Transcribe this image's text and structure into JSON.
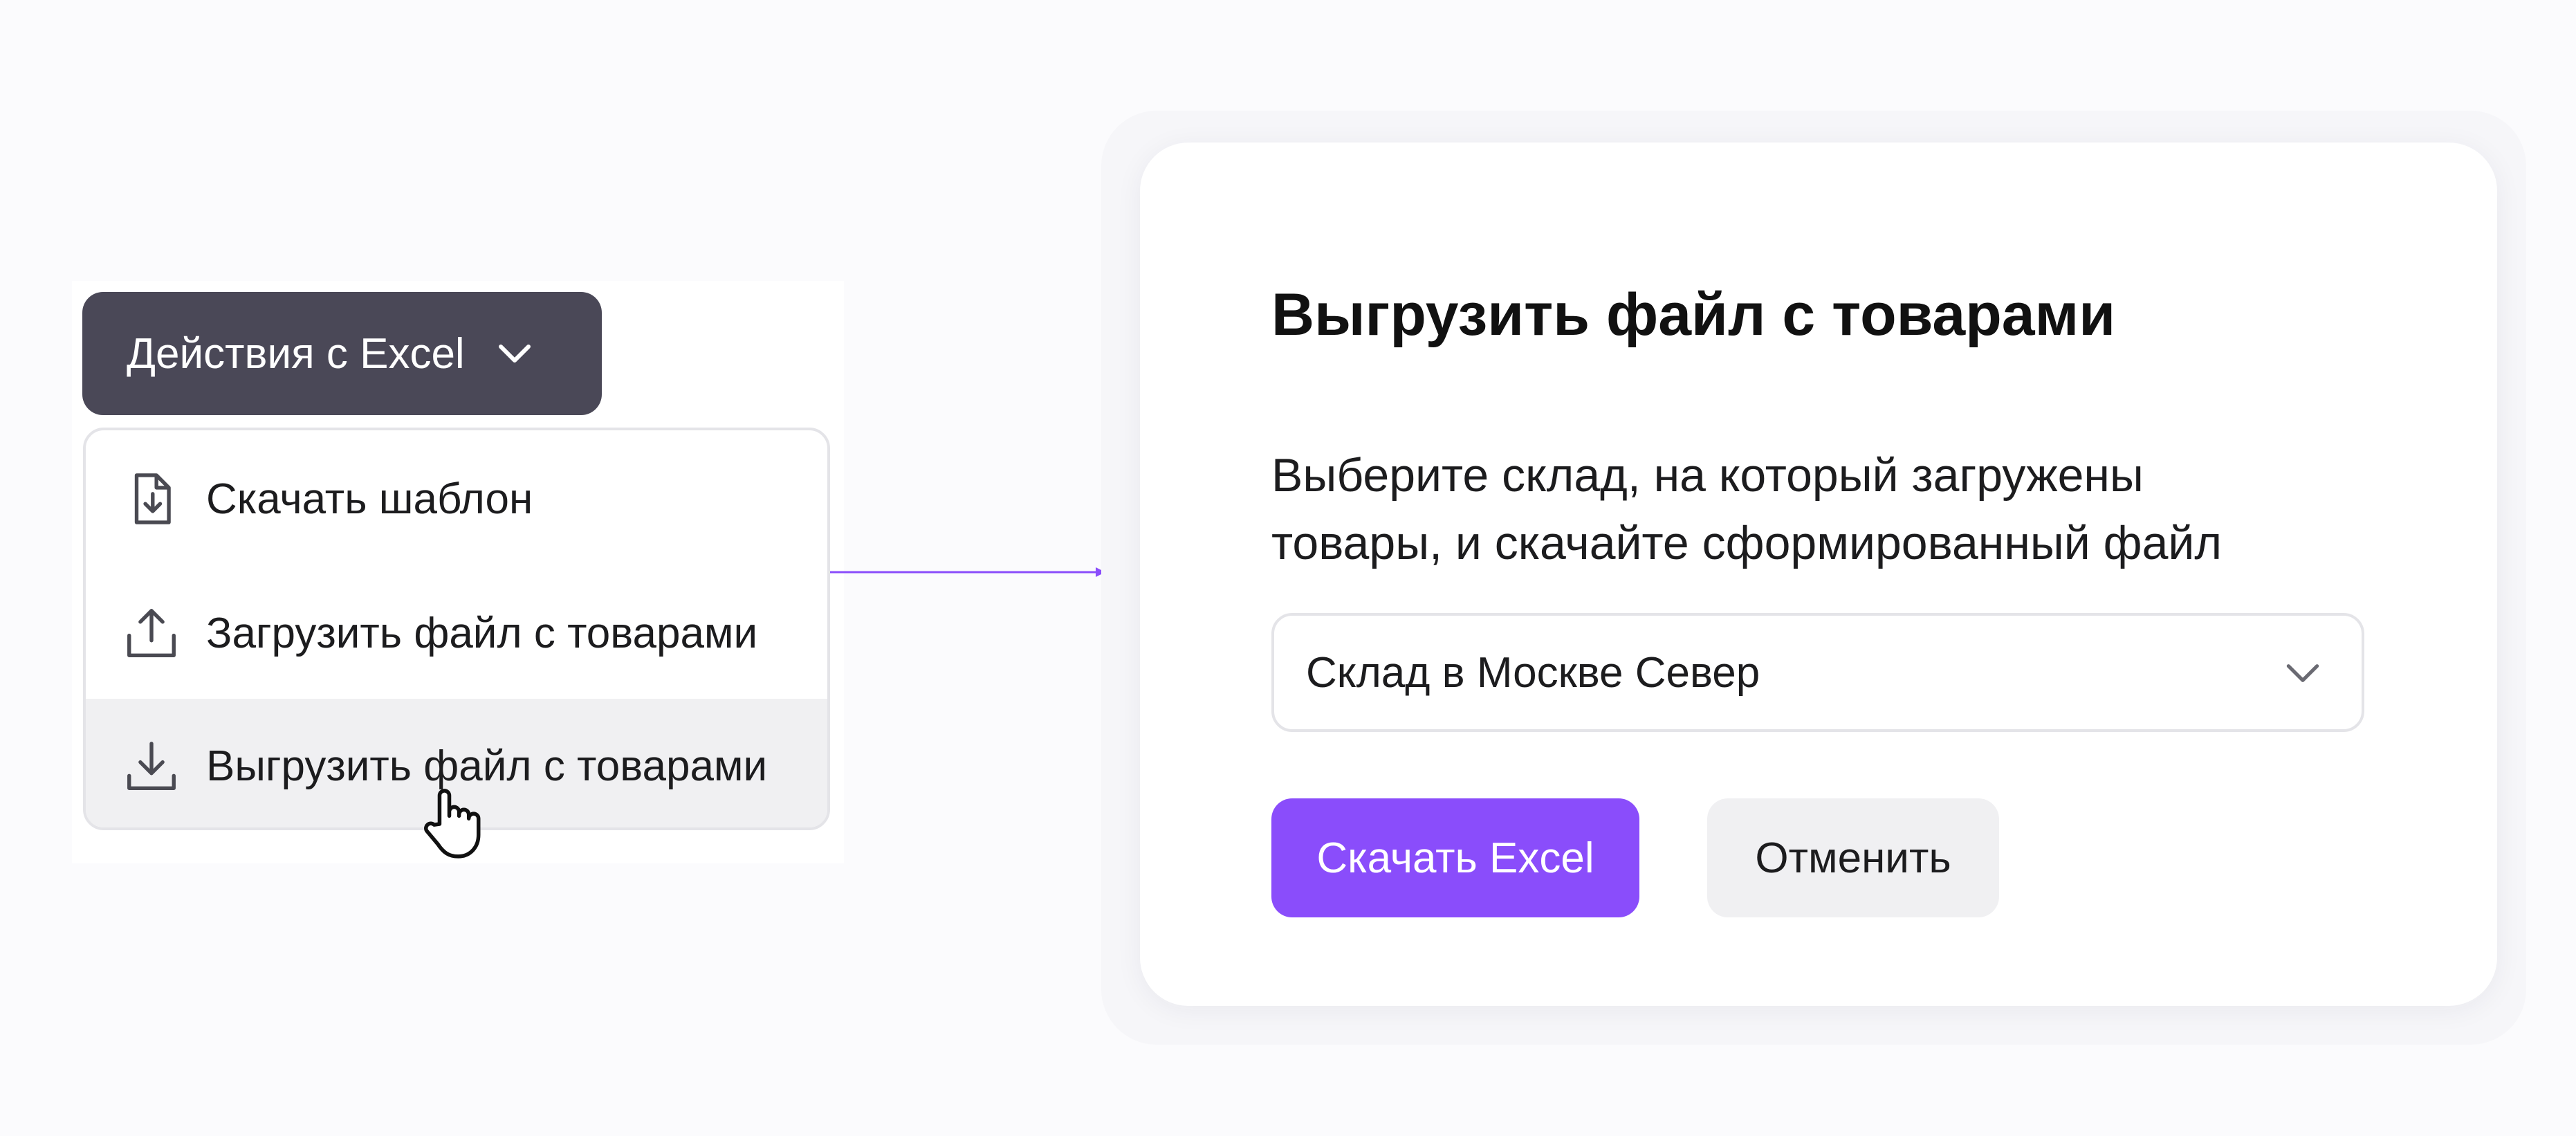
{
  "actions_button": {
    "label": "Действия с Excel",
    "icon": "chevron-down-icon"
  },
  "menu": {
    "items": [
      {
        "label": "Скачать шаблон",
        "icon": "file-download-icon",
        "highlighted": false
      },
      {
        "label": "Загрузить файл с товарами",
        "icon": "upload-icon",
        "highlighted": false
      },
      {
        "label": "Выгрузить файл с товарами",
        "icon": "download-icon",
        "highlighted": true
      }
    ]
  },
  "modal": {
    "title": "Выгрузить файл с товарами",
    "description": "Выберите склад, на который загружены\nтовары, и скачайте сформированный файл",
    "select": {
      "value": "Склад в Москве Север",
      "icon": "chevron-down-icon"
    },
    "primary_label": "Скачать Excel",
    "secondary_label": "Отменить"
  },
  "colors": {
    "accent": "#8a4dfb",
    "dark_button": "#4a4857",
    "highlight_row": "#f0f0f2",
    "connector": "#8a4dfb"
  }
}
